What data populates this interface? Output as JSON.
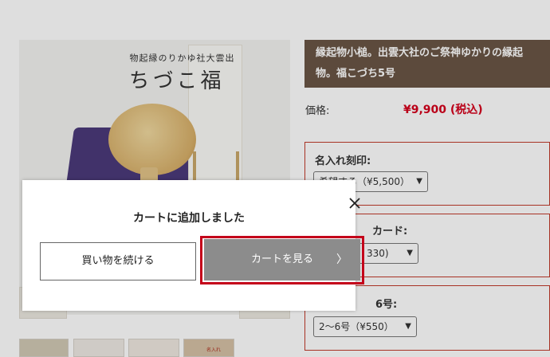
{
  "product": {
    "title": "縁起物小槌。出雲大社のご祭神ゆかりの縁起物。福こづち5号",
    "banner_small": "出雲大社ゆかりの縁起物",
    "banner_big": "福こづち",
    "price_label": "価格:",
    "price_value": "¥9,900 (税込)"
  },
  "options": [
    {
      "label": "名入れ刻印:",
      "selected": "希望する（¥5,500）"
    },
    {
      "label": "カード:",
      "selected": "330)"
    },
    {
      "label": "6号:",
      "selected": "2～6号（¥550）"
    }
  ],
  "thumbnails": [
    {
      "label": ""
    },
    {
      "label": ""
    },
    {
      "label": ""
    },
    {
      "label": "名入れ"
    }
  ],
  "modal": {
    "title": "カートに追加しました",
    "continue_label": "買い物を続ける",
    "view_cart_label": "カートを見る",
    "view_cart_arrow": "〉",
    "close_glyph": "✕"
  },
  "colors": {
    "accent": "#d6001c",
    "title_bg": "#6a5545",
    "highlight": "#c4001a",
    "cart_button": "#8c8c8c"
  }
}
